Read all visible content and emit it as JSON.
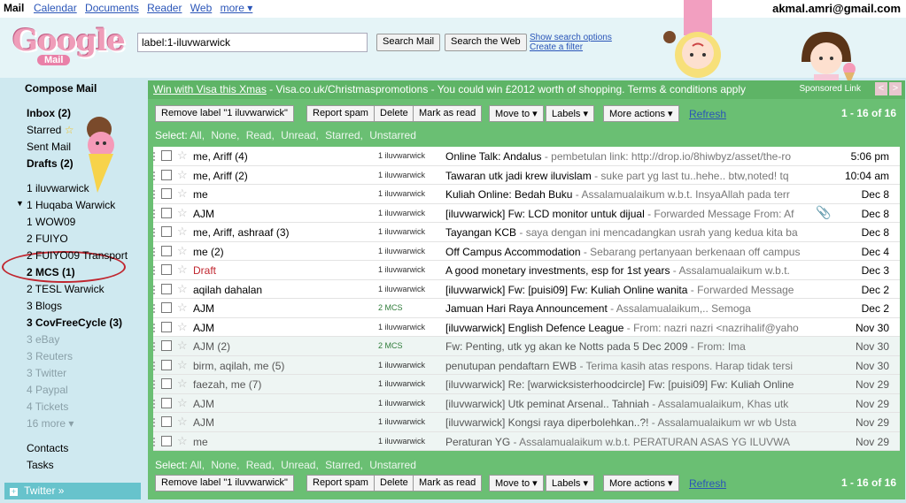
{
  "topnav": {
    "app": "Mail",
    "links": [
      "Calendar",
      "Documents",
      "Reader",
      "Web",
      "more ▾"
    ],
    "user": "akmal.amri@gmail.com"
  },
  "header": {
    "logo_text": "Google",
    "logo_sub": "Mail",
    "search_value": "label:1-iluvwarwick",
    "search_mail": "Search Mail",
    "search_web": "Search the Web",
    "show_options": "Show search options",
    "create_filter": "Create a filter"
  },
  "sidebar": {
    "compose": "Compose Mail",
    "inbox": "Inbox (2)",
    "starred": "Starred",
    "sent": "Sent Mail",
    "drafts": "Drafts (2)",
    "labels": [
      {
        "text": "1 iluvwarwick",
        "bold": false,
        "faded": false
      },
      {
        "text": "1 Huqaba Warwick",
        "bold": false,
        "faded": false
      },
      {
        "text": "1 WOW09",
        "bold": false,
        "faded": false
      },
      {
        "text": "2 FUIYO",
        "bold": false,
        "faded": false
      },
      {
        "text": "2 FUIYO09 Transport",
        "bold": false,
        "faded": false
      },
      {
        "text": "2 MCS (1)",
        "bold": true,
        "faded": false
      },
      {
        "text": "2 TESL Warwick",
        "bold": false,
        "faded": false
      },
      {
        "text": "3 Blogs",
        "bold": false,
        "faded": false
      },
      {
        "text": "3 CovFreeCycle (3)",
        "bold": true,
        "faded": false
      },
      {
        "text": "3 eBay",
        "bold": false,
        "faded": true
      },
      {
        "text": "3 Reuters",
        "bold": false,
        "faded": true
      },
      {
        "text": "3 Twitter",
        "bold": false,
        "faded": true
      },
      {
        "text": "4 Paypal",
        "bold": false,
        "faded": true
      },
      {
        "text": "4 Tickets",
        "bold": false,
        "faded": true
      },
      {
        "text": "16 more ▾",
        "bold": false,
        "faded": true
      }
    ],
    "contacts": "Contacts",
    "tasks": "Tasks",
    "twitter": "Twitter »"
  },
  "promo": {
    "link": "Win with Visa this Xmas",
    "text": " - Visa.co.uk/Christmaspromotions - You could win £2012 worth of shopping. Terms & conditions apply",
    "sponsored": "Sponsored Link",
    "prev": "<",
    "next": ">"
  },
  "toolbar": {
    "remove_label": "Remove label \"1 iluvwarwick\"",
    "report_spam": "Report spam",
    "delete": "Delete",
    "mark_read": "Mark as read",
    "move_to": "Move to ▾",
    "labels": "Labels ▾",
    "more_actions": "More actions ▾",
    "refresh": "Refresh",
    "pager": "1 - 16 of 16"
  },
  "selectbar": {
    "prefix": "Select:",
    "options": [
      "All,",
      "None,",
      "Read,",
      "Unread,",
      "Starred,",
      "Unstarred"
    ]
  },
  "emails": [
    {
      "sender": "me, Ariff (4)",
      "label": "1 iluvwarwick",
      "subject": "Online Talk: Andalus",
      "snippet": " - pembetulan link: http://drop.io/8hiwbyz/asset/the-ro",
      "date": "5:06 pm",
      "read": false,
      "attach": false,
      "draft": false,
      "alt": false
    },
    {
      "sender": "me, Ariff (2)",
      "label": "1 iluvwarwick",
      "subject": "Tawaran utk jadi krew iluvislam",
      "snippet": " - suke part yg last tu..hehe.. btw,noted! tq",
      "date": "10:04 am",
      "read": false,
      "attach": false,
      "draft": false,
      "alt": false
    },
    {
      "sender": "me",
      "label": "1 iluvwarwick",
      "subject": "Kuliah Online: Bedah Buku",
      "snippet": " - Assalamualaikum w.b.t. InsyaAllah pada terr",
      "date": "Dec 8",
      "read": false,
      "attach": false,
      "draft": false,
      "alt": false
    },
    {
      "sender": "AJM",
      "label": "1 iluvwarwick",
      "subject": "[iluvwarwick] Fw: LCD monitor untuk dijual",
      "snippet": " - Forwarded Message From: Af",
      "date": "Dec 8",
      "read": false,
      "attach": true,
      "draft": false,
      "alt": false
    },
    {
      "sender": "me, Ariff, ashraaf (3)",
      "label": "1 iluvwarwick",
      "subject": "Tayangan KCB",
      "snippet": " - saya dengan ini mencadangkan usrah yang kedua kita ba",
      "date": "Dec 8",
      "read": false,
      "attach": false,
      "draft": false,
      "alt": false
    },
    {
      "sender": "me (2)",
      "label": "1 iluvwarwick",
      "subject": "Off Campus Accommodation",
      "snippet": " - Sebarang pertanyaan berkenaan off campus",
      "date": "Dec 4",
      "read": false,
      "attach": false,
      "draft": false,
      "alt": false
    },
    {
      "sender": "Draft",
      "label": "1 iluvwarwick",
      "subject": "A good monetary investments, esp for 1st years",
      "snippet": " - Assalamualaikum w.b.t.",
      "date": "Dec 3",
      "read": false,
      "attach": false,
      "draft": true,
      "alt": false
    },
    {
      "sender": "aqilah dahalan",
      "label": "1 iluvwarwick",
      "subject": "[iluvwarwick] Fw: [puisi09] Fw: Kuliah Online wanita",
      "snippet": " - Forwarded Message",
      "date": "Dec 2",
      "read": false,
      "attach": false,
      "draft": false,
      "alt": false
    },
    {
      "sender": "AJM",
      "label": "2 MCS",
      "subject": "Jamuan Hari Raya Announcement",
      "snippet": " - Assalamualaikum,.. Semoga",
      "date": "Dec 2",
      "read": false,
      "attach": false,
      "draft": false,
      "alt": true
    },
    {
      "sender": "AJM",
      "label": "1 iluvwarwick",
      "subject": "[iluvwarwick] English Defence League",
      "snippet": " - From: nazri nazri <nazrihalif@yaho",
      "date": "Nov 30",
      "read": false,
      "attach": false,
      "draft": false,
      "alt": false
    },
    {
      "sender": "AJM (2)",
      "label": "2 MCS",
      "subject": "Fw: Penting, utk yg akan ke Notts pada 5 Dec 2009",
      "snippet": " - From: Ima",
      "date": "Nov 30",
      "read": true,
      "attach": false,
      "draft": false,
      "alt": true
    },
    {
      "sender": "birm, aqilah, me (5)",
      "label": "1 iluvwarwick",
      "subject": "penutupan pendaftarn EWB",
      "snippet": " - Terima kasih atas respons. Harap tidak tersi",
      "date": "Nov 30",
      "read": true,
      "attach": false,
      "draft": false,
      "alt": false
    },
    {
      "sender": "faezah, me (7)",
      "label": "1 iluvwarwick",
      "subject": "[iluvwarwick] Re: [warwicksisterhoodcircle] Fw: [puisi09] Fw: Kuliah Online",
      "snippet": "",
      "date": "Nov 29",
      "read": true,
      "attach": false,
      "draft": false,
      "alt": false
    },
    {
      "sender": "AJM",
      "label": "1 iluvwarwick",
      "subject": "[iluvwarwick] Utk peminat Arsenal.. Tahniah",
      "snippet": " - Assalamualaikum, Khas utk",
      "date": "Nov 29",
      "read": true,
      "attach": false,
      "draft": false,
      "alt": false
    },
    {
      "sender": "AJM",
      "label": "1 iluvwarwick",
      "subject": "[iluvwarwick] Kongsi raya diperbolehkan..?!",
      "snippet": " - Assalamualaikum wr wb Usta",
      "date": "Nov 29",
      "read": true,
      "attach": false,
      "draft": false,
      "alt": false
    },
    {
      "sender": "me",
      "label": "1 iluvwarwick",
      "subject": "Peraturan YG",
      "snippet": " - Assalamualaikum w.b.t. PERATURAN ASAS YG ILUVWA",
      "date": "Nov 29",
      "read": true,
      "attach": false,
      "draft": false,
      "alt": false
    }
  ]
}
